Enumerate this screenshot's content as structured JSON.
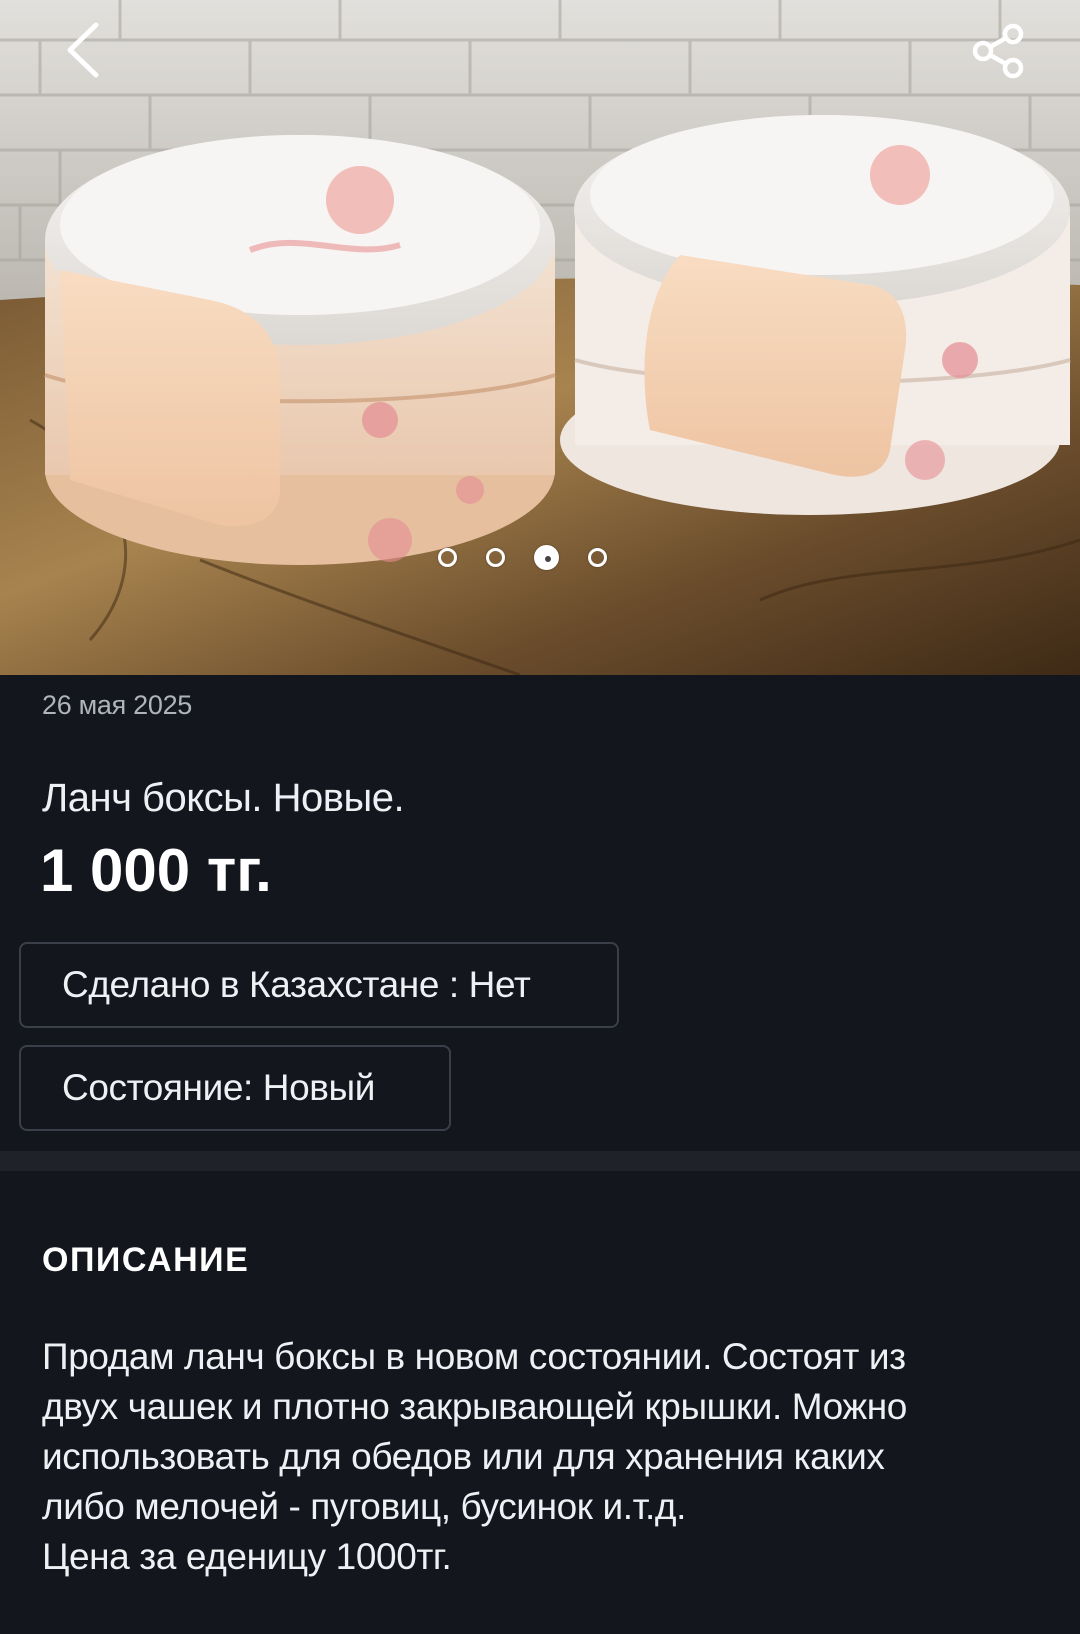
{
  "header": {
    "back_icon": "chevron-left-icon",
    "share_icon": "share-icon"
  },
  "gallery": {
    "image_count": 4,
    "active_index": 2
  },
  "listing": {
    "date": "26 мая 2025",
    "title": "Ланч боксы. Новые.",
    "price": "1 000 тг.",
    "attributes": [
      "Сделано в Казахстане : Нет",
      "Состояние: Новый"
    ]
  },
  "description": {
    "heading": "ОПИСАНИЕ",
    "lines": [
      "Продам ланч боксы в новом состоянии. Состоят из",
      "двух чашек и плотно закрывающей крышки. Можно",
      "использовать для обедов или для хранения каких",
      "либо мелочей - пуговиц, бусинок и.т.д.",
      "Цена за еденицу 1000тг."
    ]
  },
  "colors": {
    "background": "#13161d",
    "divider": "#1f2228",
    "chip_border": "#3a3f49",
    "text_primary": "#eef0f3",
    "text_muted": "#aeb3bc"
  }
}
